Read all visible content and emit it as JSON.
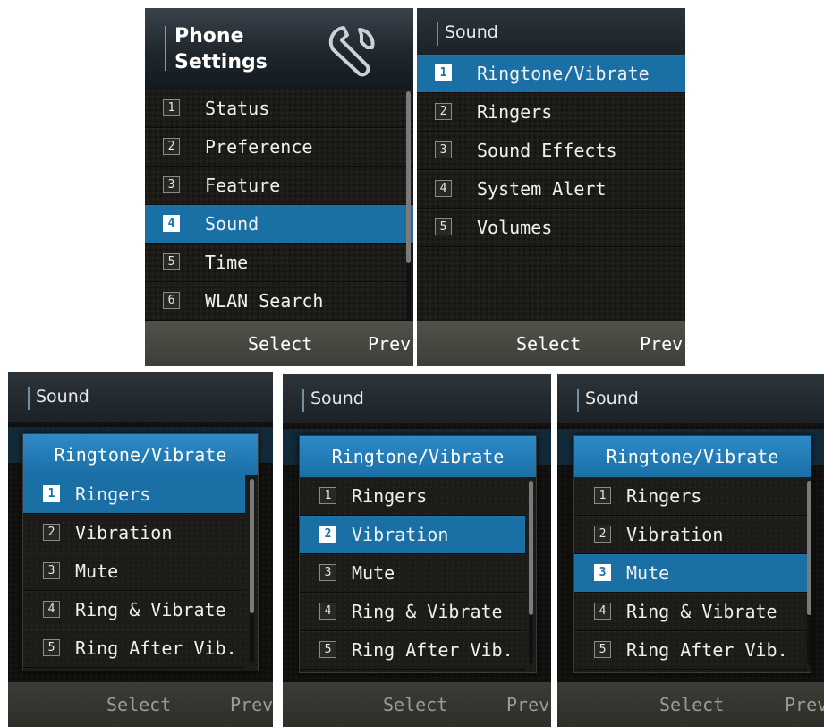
{
  "screens": [
    {
      "header": "Phone Settings",
      "header_icon": "wrench-icon",
      "items": [
        {
          "num": "1",
          "label": "Status"
        },
        {
          "num": "2",
          "label": "Preference"
        },
        {
          "num": "3",
          "label": "Feature"
        },
        {
          "num": "4",
          "label": "Sound",
          "selected": true
        },
        {
          "num": "5",
          "label": "Time"
        },
        {
          "num": "6",
          "label": "WLAN Search"
        }
      ],
      "softkeys": {
        "center": "Select",
        "right": "Prev"
      }
    },
    {
      "header": "Sound",
      "items": [
        {
          "num": "1",
          "label": "Ringtone/Vibrate",
          "selected": true
        },
        {
          "num": "2",
          "label": "Ringers"
        },
        {
          "num": "3",
          "label": "Sound Effects"
        },
        {
          "num": "4",
          "label": "System Alert"
        },
        {
          "num": "5",
          "label": "Volumes"
        }
      ],
      "softkeys": {
        "center": "Select",
        "right": "Prev"
      }
    },
    {
      "header": "Sound",
      "popup": {
        "title": "Ringtone/Vibrate",
        "items": [
          {
            "num": "1",
            "label": "Ringers",
            "selected": true
          },
          {
            "num": "2",
            "label": "Vibration"
          },
          {
            "num": "3",
            "label": "Mute"
          },
          {
            "num": "4",
            "label": "Ring & Vibrate"
          },
          {
            "num": "5",
            "label": "Ring After Vib."
          }
        ]
      },
      "softkeys": {
        "center": "Select",
        "right": "Prev"
      }
    },
    {
      "header": "Sound",
      "popup": {
        "title": "Ringtone/Vibrate",
        "items": [
          {
            "num": "1",
            "label": "Ringers"
          },
          {
            "num": "2",
            "label": "Vibration",
            "selected": true
          },
          {
            "num": "3",
            "label": "Mute"
          },
          {
            "num": "4",
            "label": "Ring & Vibrate"
          },
          {
            "num": "5",
            "label": "Ring After Vib."
          }
        ]
      },
      "softkeys": {
        "center": "Select",
        "right": "Prev"
      }
    },
    {
      "header": "Sound",
      "popup": {
        "title": "Ringtone/Vibrate",
        "items": [
          {
            "num": "1",
            "label": "Ringers"
          },
          {
            "num": "2",
            "label": "Vibration"
          },
          {
            "num": "3",
            "label": "Mute",
            "selected": true
          },
          {
            "num": "4",
            "label": "Ring & Vibrate"
          },
          {
            "num": "5",
            "label": "Ring After Vib."
          }
        ]
      },
      "softkeys": {
        "center": "Select",
        "right": "Prev"
      }
    }
  ],
  "colors": {
    "selection": "#1a6fa5",
    "background": "#1d1b17",
    "softbar": "#44473f"
  }
}
